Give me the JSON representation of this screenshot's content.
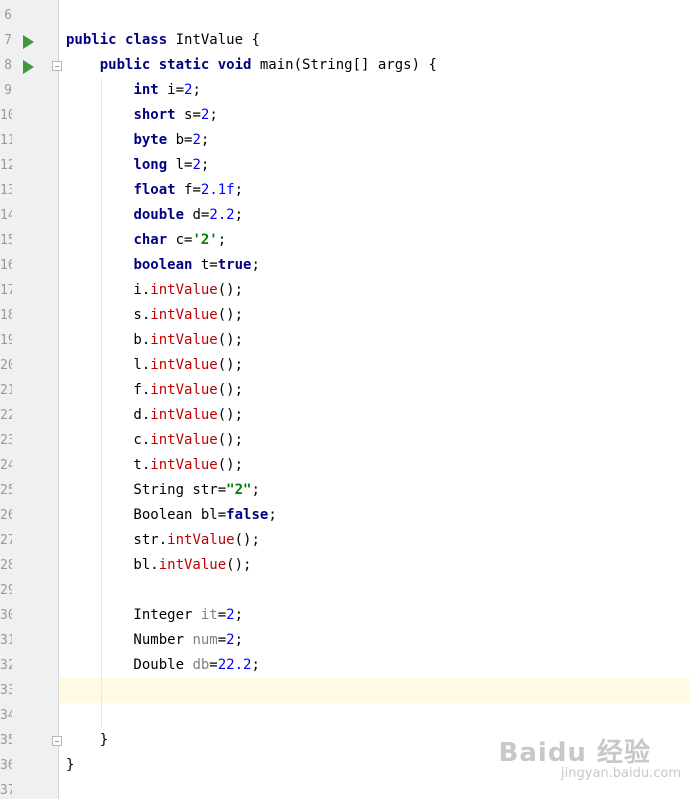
{
  "editor": {
    "lines": [
      {
        "num": "6",
        "tokens": []
      },
      {
        "num": "7",
        "run": true,
        "tokens": [
          {
            "t": "public class",
            "c": "keyword"
          },
          {
            "t": " IntValue {",
            "c": "plain"
          }
        ]
      },
      {
        "num": "8",
        "run": true,
        "fold": true,
        "tokens": [
          {
            "t": "    ",
            "c": "plain"
          },
          {
            "t": "public static void",
            "c": "keyword"
          },
          {
            "t": " main(String[] args) {",
            "c": "plain"
          }
        ]
      },
      {
        "num": "9",
        "tokens": [
          {
            "t": "        ",
            "c": "plain"
          },
          {
            "t": "int",
            "c": "keyword"
          },
          {
            "t": " i=",
            "c": "plain"
          },
          {
            "t": "2",
            "c": "number"
          },
          {
            "t": ";",
            "c": "plain"
          }
        ]
      },
      {
        "num": "10",
        "tokens": [
          {
            "t": "        ",
            "c": "plain"
          },
          {
            "t": "short",
            "c": "keyword"
          },
          {
            "t": " s=",
            "c": "plain"
          },
          {
            "t": "2",
            "c": "number"
          },
          {
            "t": ";",
            "c": "plain"
          }
        ]
      },
      {
        "num": "11",
        "tokens": [
          {
            "t": "        ",
            "c": "plain"
          },
          {
            "t": "byte",
            "c": "keyword"
          },
          {
            "t": " b=",
            "c": "plain"
          },
          {
            "t": "2",
            "c": "number"
          },
          {
            "t": ";",
            "c": "plain"
          }
        ]
      },
      {
        "num": "12",
        "tokens": [
          {
            "t": "        ",
            "c": "plain"
          },
          {
            "t": "long",
            "c": "keyword"
          },
          {
            "t": " l=",
            "c": "plain"
          },
          {
            "t": "2",
            "c": "number"
          },
          {
            "t": ";",
            "c": "plain"
          }
        ]
      },
      {
        "num": "13",
        "tokens": [
          {
            "t": "        ",
            "c": "plain"
          },
          {
            "t": "float",
            "c": "keyword"
          },
          {
            "t": " f=",
            "c": "plain"
          },
          {
            "t": "2.1f",
            "c": "number"
          },
          {
            "t": ";",
            "c": "plain"
          }
        ]
      },
      {
        "num": "14",
        "tokens": [
          {
            "t": "        ",
            "c": "plain"
          },
          {
            "t": "double",
            "c": "keyword"
          },
          {
            "t": " d=",
            "c": "plain"
          },
          {
            "t": "2.2",
            "c": "number"
          },
          {
            "t": ";",
            "c": "plain"
          }
        ]
      },
      {
        "num": "15",
        "tokens": [
          {
            "t": "        ",
            "c": "plain"
          },
          {
            "t": "char",
            "c": "keyword"
          },
          {
            "t": " c=",
            "c": "plain"
          },
          {
            "t": "'2'",
            "c": "string"
          },
          {
            "t": ";",
            "c": "plain"
          }
        ]
      },
      {
        "num": "16",
        "tokens": [
          {
            "t": "        ",
            "c": "plain"
          },
          {
            "t": "boolean",
            "c": "keyword"
          },
          {
            "t": " t=",
            "c": "plain"
          },
          {
            "t": "true",
            "c": "keyword"
          },
          {
            "t": ";",
            "c": "plain"
          }
        ]
      },
      {
        "num": "17",
        "tokens": [
          {
            "t": "        i.",
            "c": "plain"
          },
          {
            "t": "intValue",
            "c": "method"
          },
          {
            "t": "();",
            "c": "plain"
          }
        ]
      },
      {
        "num": "18",
        "tokens": [
          {
            "t": "        s.",
            "c": "plain"
          },
          {
            "t": "intValue",
            "c": "method"
          },
          {
            "t": "();",
            "c": "plain"
          }
        ]
      },
      {
        "num": "19",
        "tokens": [
          {
            "t": "        b.",
            "c": "plain"
          },
          {
            "t": "intValue",
            "c": "method"
          },
          {
            "t": "();",
            "c": "plain"
          }
        ]
      },
      {
        "num": "20",
        "tokens": [
          {
            "t": "        l.",
            "c": "plain"
          },
          {
            "t": "intValue",
            "c": "method"
          },
          {
            "t": "();",
            "c": "plain"
          }
        ]
      },
      {
        "num": "21",
        "tokens": [
          {
            "t": "        f.",
            "c": "plain"
          },
          {
            "t": "intValue",
            "c": "method"
          },
          {
            "t": "();",
            "c": "plain"
          }
        ]
      },
      {
        "num": "22",
        "tokens": [
          {
            "t": "        d.",
            "c": "plain"
          },
          {
            "t": "intValue",
            "c": "method"
          },
          {
            "t": "();",
            "c": "plain"
          }
        ]
      },
      {
        "num": "23",
        "tokens": [
          {
            "t": "        c.",
            "c": "plain"
          },
          {
            "t": "intValue",
            "c": "method"
          },
          {
            "t": "();",
            "c": "plain"
          }
        ]
      },
      {
        "num": "24",
        "tokens": [
          {
            "t": "        t.",
            "c": "plain"
          },
          {
            "t": "intValue",
            "c": "method"
          },
          {
            "t": "();",
            "c": "plain"
          }
        ]
      },
      {
        "num": "25",
        "tokens": [
          {
            "t": "        String str=",
            "c": "plain"
          },
          {
            "t": "\"2\"",
            "c": "string"
          },
          {
            "t": ";",
            "c": "plain"
          }
        ]
      },
      {
        "num": "26",
        "tokens": [
          {
            "t": "        Boolean bl=",
            "c": "plain"
          },
          {
            "t": "false",
            "c": "keyword"
          },
          {
            "t": ";",
            "c": "plain"
          }
        ]
      },
      {
        "num": "27",
        "tokens": [
          {
            "t": "        str.",
            "c": "plain"
          },
          {
            "t": "intValue",
            "c": "method"
          },
          {
            "t": "();",
            "c": "plain"
          }
        ]
      },
      {
        "num": "28",
        "tokens": [
          {
            "t": "        bl.",
            "c": "plain"
          },
          {
            "t": "intValue",
            "c": "method"
          },
          {
            "t": "();",
            "c": "plain"
          }
        ]
      },
      {
        "num": "29",
        "tokens": []
      },
      {
        "num": "30",
        "tokens": [
          {
            "t": "        Integer ",
            "c": "plain"
          },
          {
            "t": "it",
            "c": "unused"
          },
          {
            "t": "=",
            "c": "plain"
          },
          {
            "t": "2",
            "c": "number"
          },
          {
            "t": ";",
            "c": "plain"
          }
        ]
      },
      {
        "num": "31",
        "tokens": [
          {
            "t": "        Number ",
            "c": "plain"
          },
          {
            "t": "num",
            "c": "unused"
          },
          {
            "t": "=",
            "c": "plain"
          },
          {
            "t": "2",
            "c": "number"
          },
          {
            "t": ";",
            "c": "plain"
          }
        ]
      },
      {
        "num": "32",
        "tokens": [
          {
            "t": "        Double ",
            "c": "plain"
          },
          {
            "t": "db",
            "c": "unused"
          },
          {
            "t": "=",
            "c": "plain"
          },
          {
            "t": "22.2",
            "c": "number"
          },
          {
            "t": ";",
            "c": "plain"
          }
        ]
      },
      {
        "num": "33",
        "current": true,
        "tokens": []
      },
      {
        "num": "34",
        "tokens": []
      },
      {
        "num": "35",
        "fold": true,
        "tokens": [
          {
            "t": "    }",
            "c": "plain"
          }
        ]
      },
      {
        "num": "36",
        "tokens": [
          {
            "t": "}",
            "c": "plain"
          }
        ]
      },
      {
        "num": "37",
        "tokens": []
      }
    ]
  },
  "colors": {
    "keyword": "#000080",
    "number": "#0000ff",
    "string": "#008000",
    "method": "#c00000",
    "unused": "#808080",
    "current_line": "#fffae3",
    "gutter": "#f0f0f0",
    "run_icon": "#3a9b3a"
  },
  "watermark": {
    "logo": "Baidu 经验",
    "url": "jingyan.baidu.com"
  }
}
